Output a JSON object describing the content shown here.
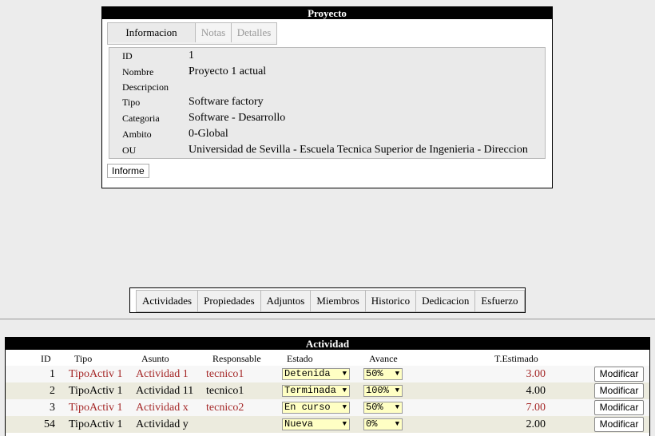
{
  "proyecto": {
    "title": "Proyecto",
    "tabs": [
      "Informacion",
      "Notas",
      "Detalles"
    ],
    "fields": [
      {
        "label": "ID",
        "value": "1"
      },
      {
        "label": "Nombre",
        "value": "Proyecto 1 actual"
      },
      {
        "label": "Descripcion",
        "value": ""
      },
      {
        "label": "Tipo",
        "value": "Software factory"
      },
      {
        "label": "Categoria",
        "value": "Software - Desarrollo"
      },
      {
        "label": "Ambito",
        "value": "0-Global"
      },
      {
        "label": "OU",
        "value": "Universidad de Sevilla - Escuela Tecnica Superior de Ingenieria - Direccion"
      }
    ],
    "informe_label": "Informe"
  },
  "tabs": [
    "Actividades",
    "Propiedades",
    "Adjuntos",
    "Miembros",
    "Historico",
    "Dedicacion",
    "Esfuerzo"
  ],
  "actividad": {
    "title": "Actividad",
    "columns": [
      "ID",
      "Tipo",
      "Asunto",
      "Responsable",
      "Estado",
      "Avance",
      "T.Estimado"
    ],
    "modify_label": "Modificar",
    "rows": [
      {
        "id": "1",
        "tipo": "TipoActiv 1",
        "asunto": "Actividad 1",
        "responsable": "tecnico1",
        "estado": "Detenida",
        "avance": "50%",
        "estimado": "3.00",
        "highlight": true
      },
      {
        "id": "2",
        "tipo": "TipoActiv 1",
        "asunto": "Actividad 11",
        "responsable": "tecnico1",
        "estado": "Terminada",
        "avance": "100%",
        "estimado": "4.00",
        "highlight": false
      },
      {
        "id": "3",
        "tipo": "TipoActiv 1",
        "asunto": "Actividad x",
        "responsable": "tecnico2",
        "estado": "En curso",
        "avance": "50%",
        "estimado": "7.00",
        "highlight": true
      },
      {
        "id": "54",
        "tipo": "TipoActiv 1",
        "asunto": "Actividad y",
        "responsable": "",
        "estado": "Nueva",
        "avance": "0%",
        "estimado": "2.00",
        "highlight": false
      }
    ]
  },
  "colors": {
    "highlight_text": "#a52828",
    "select_bg": "#ffffc4",
    "row_alt": "#ecebde"
  }
}
